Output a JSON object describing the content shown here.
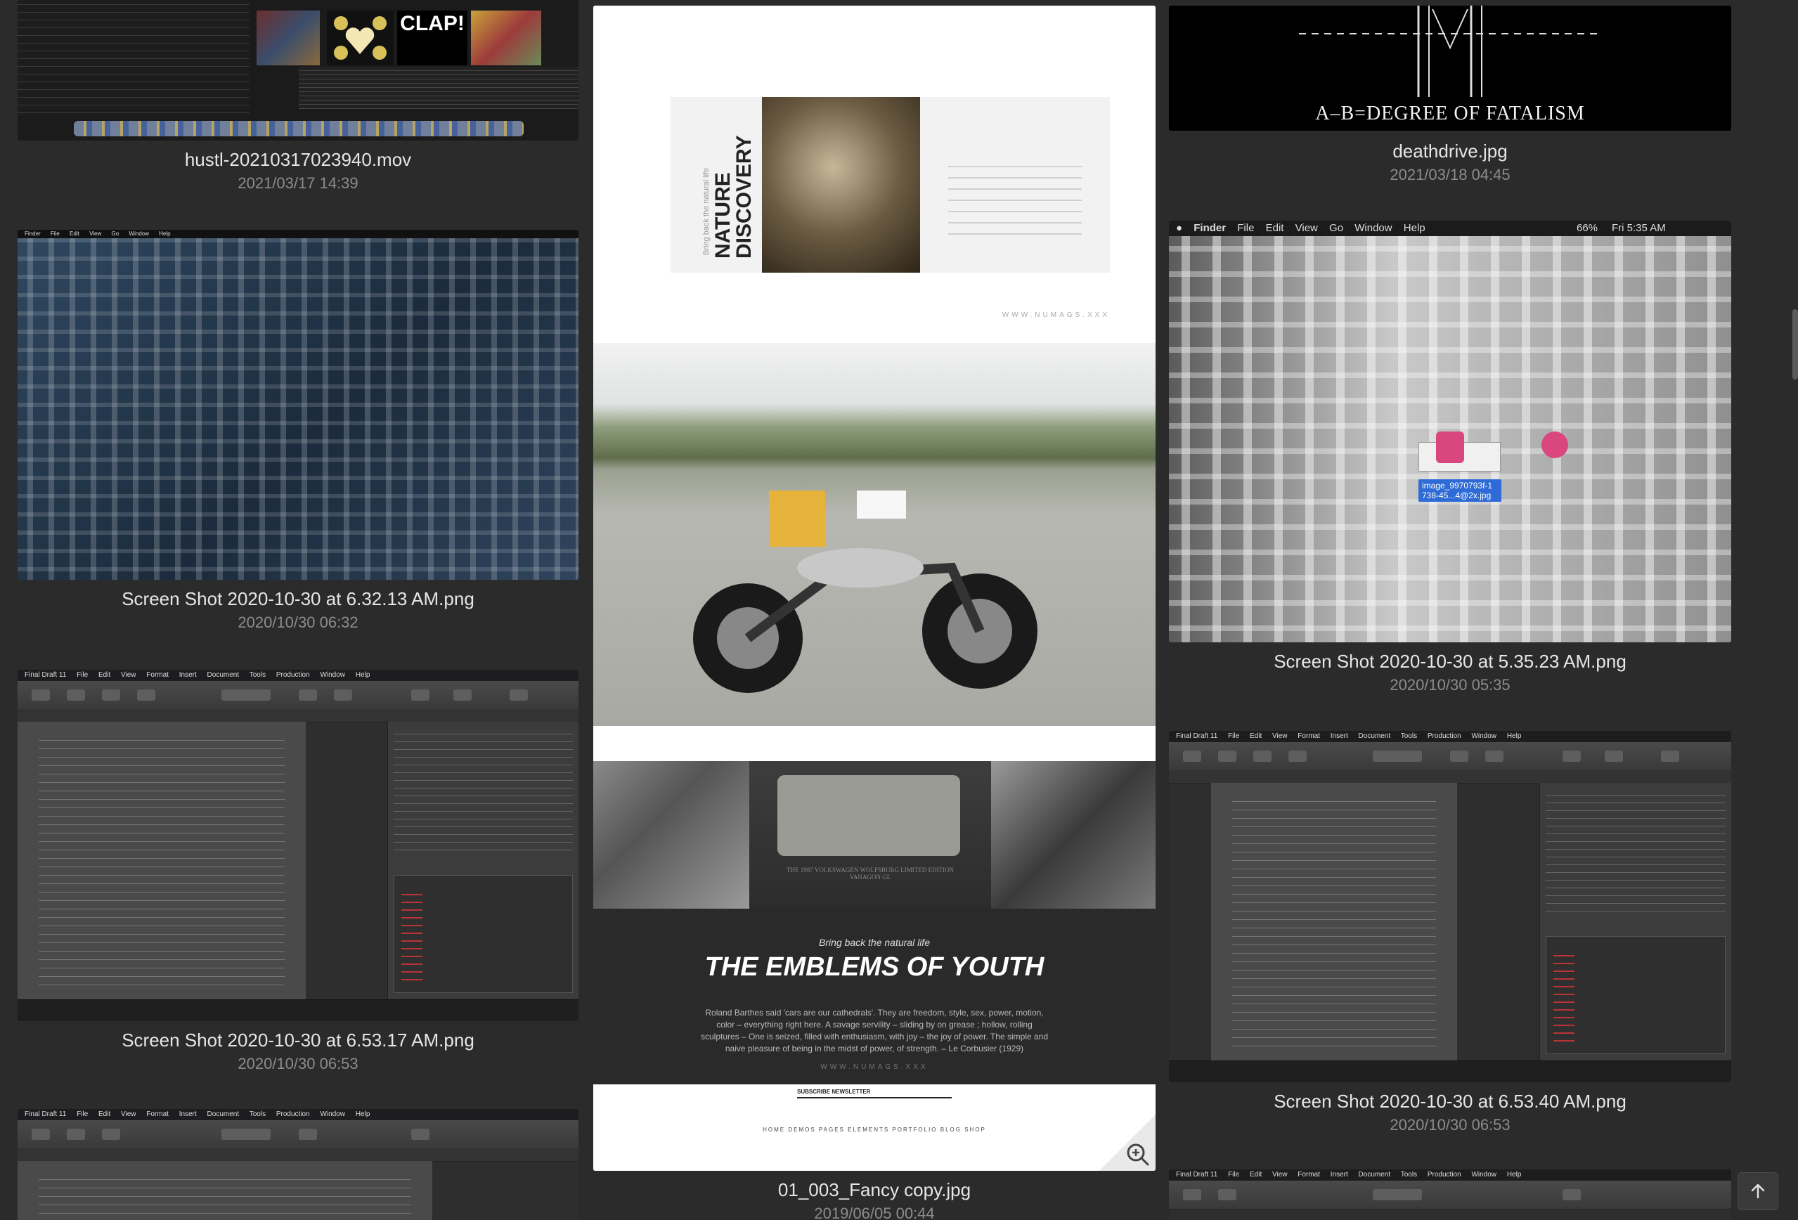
{
  "columns": {
    "col1": [
      {
        "filename": "hustl-20210317023940.mov",
        "date": "2021/03/17 14:39"
      },
      {
        "filename": "Screen Shot 2020-10-30 at 6.32.13 AM.png",
        "date": "2020/10/30 06:32"
      },
      {
        "filename": "Screen Shot 2020-10-30 at 6.53.17 AM.png",
        "date": "2020/10/30 06:53"
      }
    ],
    "col2": [
      {
        "filename": "01_003_Fancy copy.jpg",
        "date": "2019/06/05 00:44"
      }
    ],
    "col3": [
      {
        "filename": "deathdrive.jpg",
        "date": "2021/03/18 04:45"
      },
      {
        "filename": "Screen Shot 2020-10-30 at 5.35.23 AM.png",
        "date": "2020/10/30 05:35"
      },
      {
        "filename": "Screen Shot 2020-10-30 at 6.53.40 AM.png",
        "date": "2020/10/30 06:53"
      }
    ]
  },
  "thumbs": {
    "deathdrive_text": "A–B=DEGREE OF FATALISM",
    "finder_menubar": [
      "Finder",
      "File",
      "Edit",
      "View",
      "Go",
      "Window",
      "Help"
    ],
    "finder_status": [
      "66%",
      "Fri 5:35 AM"
    ],
    "finder_selected_label": "image_9970793f-1 738-45...4@2x.jpg",
    "finaldraft_menubar": [
      "Final Draft 11",
      "File",
      "Edit",
      "View",
      "Format",
      "Insert",
      "Document",
      "Tools",
      "Production",
      "Window",
      "Help"
    ],
    "magazine": {
      "vertical_title": "NATURE DISCOVERY",
      "vertical_kicker": "Bring back the natural life",
      "url": "WWW.NUMAGS.XXX",
      "kicker": "Bring back the natural life",
      "headline": "THE EMBLEMS OF YOUTH",
      "body": "Roland Barthes said 'cars are our cathedrals'. They are freedom, style, sex, power, motion, color – everything right here. A savage servility – sliding by on grease ; hollow, rolling sculptures – One is seized, filled with enthusiasm, with joy – the joy of power. The simple and naive pleasure of being in the midst of power, of strength. – Le Corbusier (1929)",
      "van_caption": "THE 1987 VOLKSWAGEN WOLFSBURG LIMITED EDITION VANAGON GL",
      "subscribe": "SUBSCRIBE NEWSLETTER",
      "footer_nav": "HOME   DEMOS   PAGES   ELEMENTS   PORTFOLIO   BLOG   SHOP"
    }
  },
  "colors": {
    "background": "#2b2b2b",
    "filename": "#e6e6e6",
    "date": "#8c8c8c",
    "selection": "#2f6bd6"
  },
  "icons": {
    "zoom": "zoom-in-icon",
    "back_to_top": "arrow-up-icon"
  }
}
